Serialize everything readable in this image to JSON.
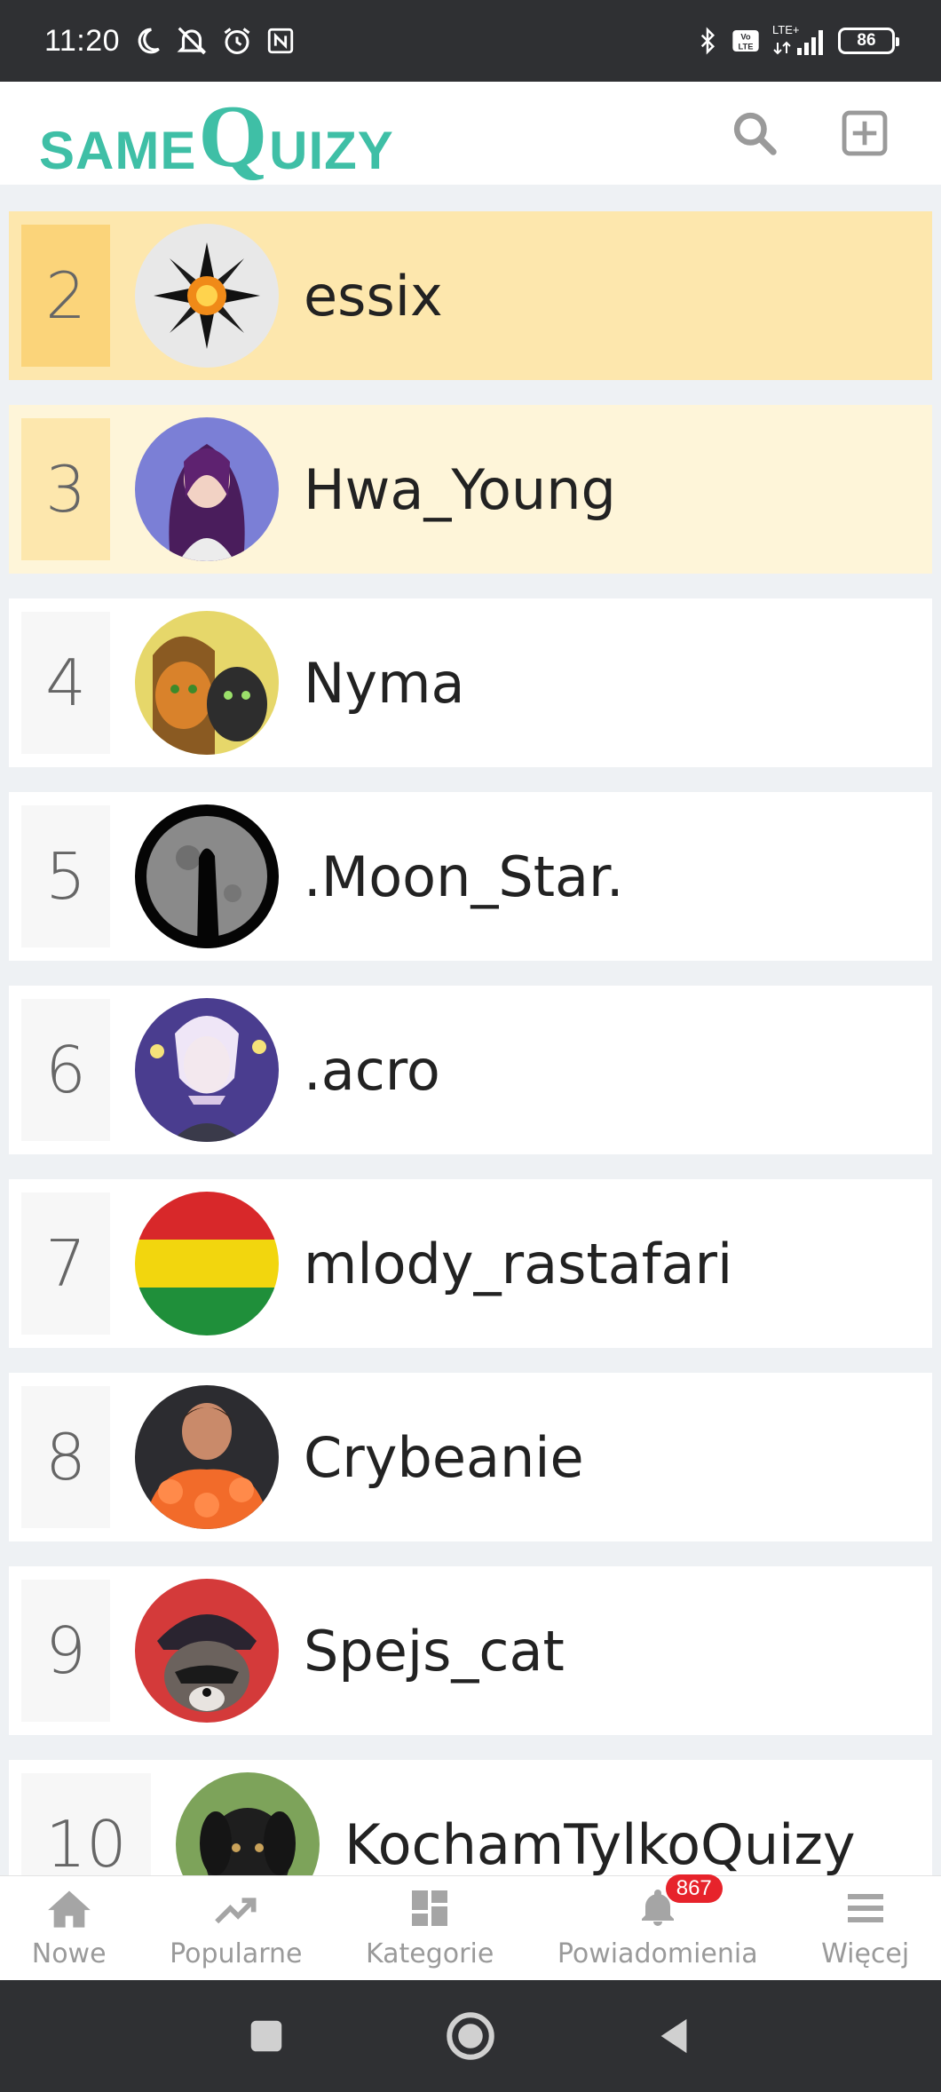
{
  "status_bar": {
    "time": "11:20",
    "battery": "86",
    "icons": [
      "moon-icon",
      "notifications-off-icon",
      "alarm-icon",
      "nfc-icon",
      "bluetooth-icon",
      "volte-icon",
      "lte-signal-icon"
    ],
    "network_label": "LTE+",
    "volte_label": "Vo LTE"
  },
  "app_header": {
    "logo_small_1": "SAME",
    "logo_big": "Q",
    "logo_small_2": "UIZY",
    "brand_color": "#3fbfa6",
    "search_icon": "search-icon",
    "add_icon": "add-square-icon"
  },
  "ranking": [
    {
      "rank": "2",
      "username": "essix",
      "highlight": "gold",
      "avatar": "flower-avatar"
    },
    {
      "rank": "3",
      "username": "Hwa_Young",
      "highlight": "cream",
      "avatar": "girl-avatar"
    },
    {
      "rank": "4",
      "username": "Nyma",
      "highlight": "none",
      "avatar": "cats-avatar"
    },
    {
      "rank": "5",
      "username": ".Moon_Star.",
      "highlight": "none",
      "avatar": "moon-avatar"
    },
    {
      "rank": "6",
      "username": ".acro",
      "highlight": "none",
      "avatar": "anime-avatar"
    },
    {
      "rank": "7",
      "username": "mlody_rastafari",
      "highlight": "none",
      "avatar": "flag-avatar"
    },
    {
      "rank": "8",
      "username": "Crybeanie",
      "highlight": "none",
      "avatar": "person-avatar"
    },
    {
      "rank": "9",
      "username": "Spejs_cat",
      "highlight": "none",
      "avatar": "raccoon-avatar"
    },
    {
      "rank": "10",
      "username": "KochamTylkoQuizy",
      "highlight": "none",
      "avatar": "dog-avatar"
    }
  ],
  "bottom_nav": {
    "items": [
      {
        "label": "Nowe",
        "icon": "home-icon"
      },
      {
        "label": "Popularne",
        "icon": "trending-icon"
      },
      {
        "label": "Kategorie",
        "icon": "dashboard-icon"
      },
      {
        "label": "Powiadomienia",
        "icon": "bell-icon",
        "badge": "867"
      },
      {
        "label": "Więcej",
        "icon": "menu-icon"
      }
    ]
  },
  "system_nav": {
    "icons": [
      "recents-icon",
      "home-circle-icon",
      "back-icon"
    ]
  },
  "colors": {
    "gold_row": "#fde7ad",
    "cream_row": "#fef5d9",
    "badge": "#e7232b"
  }
}
